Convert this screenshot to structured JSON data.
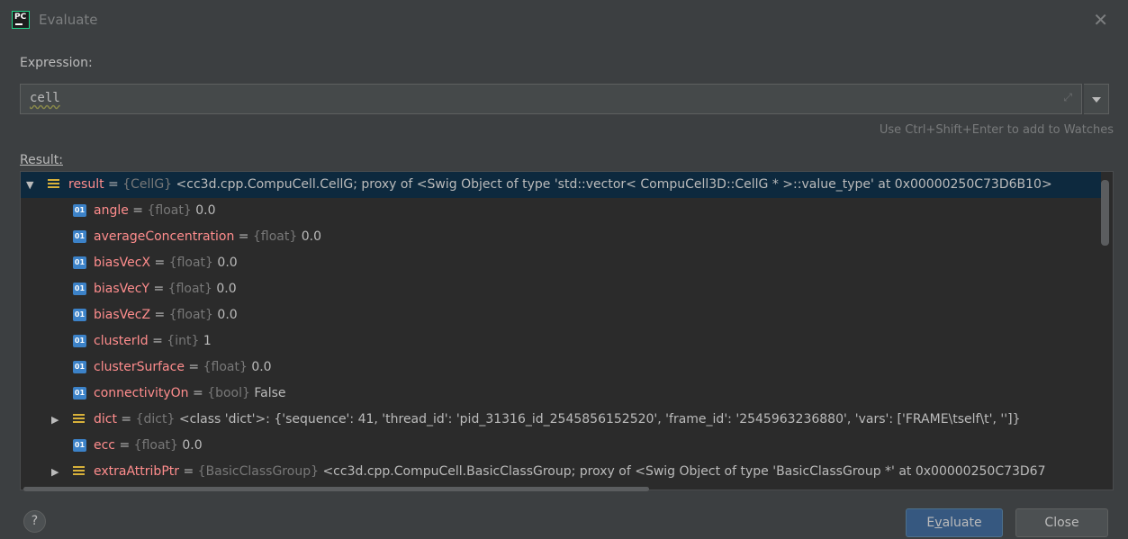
{
  "window": {
    "title": "Evaluate",
    "app_icon": "PC",
    "close_icon": "close-icon"
  },
  "expression": {
    "label": "Expression:",
    "value": "cell",
    "hint": "Use Ctrl+Shift+Enter to add to Watches"
  },
  "result": {
    "label": "Result:",
    "rows": [
      {
        "kind": "obj",
        "expander": "▼",
        "name": "result",
        "type": "{CellG}",
        "value": "<cc3d.cpp.CompuCell.CellG; proxy of <Swig Object of type 'std::vector< CompuCell3D::CellG * >::value_type' at 0x00000250C73D6B10>",
        "selected": true
      },
      {
        "kind": "field",
        "expander": "",
        "name": "angle",
        "type": "{float}",
        "value": "0.0"
      },
      {
        "kind": "field",
        "expander": "",
        "name": "averageConcentration",
        "type": "{float}",
        "value": "0.0"
      },
      {
        "kind": "field",
        "expander": "",
        "name": "biasVecX",
        "type": "{float}",
        "value": "0.0"
      },
      {
        "kind": "field",
        "expander": "",
        "name": "biasVecY",
        "type": "{float}",
        "value": "0.0"
      },
      {
        "kind": "field",
        "expander": "",
        "name": "biasVecZ",
        "type": "{float}",
        "value": "0.0"
      },
      {
        "kind": "field",
        "expander": "",
        "name": "clusterId",
        "type": "{int}",
        "value": "1"
      },
      {
        "kind": "field",
        "expander": "",
        "name": "clusterSurface",
        "type": "{float}",
        "value": "0.0"
      },
      {
        "kind": "field",
        "expander": "",
        "name": "connectivityOn",
        "type": "{bool}",
        "value": "False"
      },
      {
        "kind": "obj",
        "expander": "▶",
        "name": "dict",
        "type": "{dict}",
        "value": "<class 'dict'>: {'sequence': 41, 'thread_id': 'pid_31316_id_2545856152520', 'frame_id': '2545963236880', 'vars': ['FRAME\\tself\\t', '']}"
      },
      {
        "kind": "field",
        "expander": "",
        "name": "ecc",
        "type": "{float}",
        "value": "0.0"
      },
      {
        "kind": "obj",
        "expander": "▶",
        "name": "extraAttribPtr",
        "type": "{BasicClassGroup}",
        "value": "<cc3d.cpp.CompuCell.BasicClassGroup; proxy of <Swig Object of type 'BasicClassGroup *' at 0x00000250C73D67"
      }
    ]
  },
  "buttons": {
    "help": "?",
    "evaluate_prefix": "E",
    "evaluate_mnemonic": "v",
    "evaluate_suffix": "aluate",
    "close": "Close"
  },
  "colors": {
    "background": "#3c3f41",
    "tree_background": "#2b2b2b",
    "selection": "#0d293e",
    "name": "#ff8d8d",
    "type": "#787878",
    "primary_button": "#365880"
  }
}
